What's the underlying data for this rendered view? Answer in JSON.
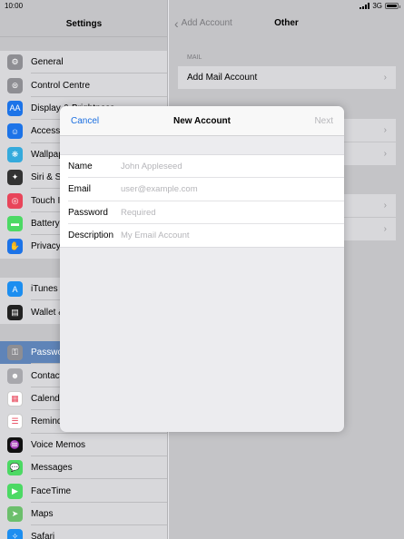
{
  "status": {
    "time": "10:00",
    "network": "3G"
  },
  "sidebar": {
    "title": "Settings",
    "group1": [
      {
        "label": "General",
        "icon": "gear-icon",
        "color": "#8e8e93",
        "glyph": "⚙"
      },
      {
        "label": "Control Centre",
        "icon": "switches-icon",
        "color": "#8e8e93",
        "glyph": "⊜"
      },
      {
        "label": "Display & Brightness",
        "icon": "text-size-icon",
        "color": "#1c73e8",
        "glyph": "AA"
      },
      {
        "label": "Accessibility",
        "icon": "accessibility-icon",
        "color": "#1c73e8",
        "glyph": "☺"
      },
      {
        "label": "Wallpaper",
        "icon": "flower-icon",
        "color": "#35aadc",
        "glyph": "❋"
      },
      {
        "label": "Siri & Search",
        "icon": "siri-icon",
        "color": "#333",
        "glyph": "✦"
      },
      {
        "label": "Touch ID & Passcode",
        "icon": "fingerprint-icon",
        "color": "#e8455a",
        "glyph": "◎"
      },
      {
        "label": "Battery",
        "icon": "battery-icon",
        "color": "#4cd964",
        "glyph": "▬"
      },
      {
        "label": "Privacy",
        "icon": "hand-icon",
        "color": "#1c73e8",
        "glyph": "✋"
      }
    ],
    "group2": [
      {
        "label": "iTunes & App Store",
        "icon": "app-store-icon",
        "color": "#1c8ef0",
        "glyph": "A"
      },
      {
        "label": "Wallet & Apple Pay",
        "icon": "wallet-icon",
        "color": "#222",
        "glyph": "▤"
      }
    ],
    "group3": [
      {
        "label": "Passwords & Accounts",
        "icon": "key-icon",
        "color": "#8e8e93",
        "glyph": "⚿",
        "selected": true
      },
      {
        "label": "Contacts",
        "icon": "contacts-icon",
        "color": "#a8a8ad",
        "glyph": "☻"
      },
      {
        "label": "Calendar",
        "icon": "calendar-icon",
        "color": "#ffffff",
        "glyph": "▦"
      },
      {
        "label": "Reminders",
        "icon": "reminders-icon",
        "color": "#ffffff",
        "glyph": "☰"
      },
      {
        "label": "Voice Memos",
        "icon": "voice-memos-icon",
        "color": "#111",
        "glyph": "♒"
      },
      {
        "label": "Messages",
        "icon": "messages-icon",
        "color": "#4cd964",
        "glyph": "💬"
      },
      {
        "label": "FaceTime",
        "icon": "facetime-icon",
        "color": "#4cd964",
        "glyph": "▶"
      },
      {
        "label": "Maps",
        "icon": "maps-icon",
        "color": "#6cbf6c",
        "glyph": "➤"
      },
      {
        "label": "Safari",
        "icon": "safari-icon",
        "color": "#1c8ef0",
        "glyph": "✧"
      }
    ]
  },
  "detail": {
    "back_label": "Add Account",
    "title": "Other",
    "mail_caption": "MAIL",
    "add_mail_label": "Add Mail Account"
  },
  "modal": {
    "cancel": "Cancel",
    "title": "New Account",
    "next": "Next",
    "fields": [
      {
        "label": "Name",
        "placeholder": "John Appleseed",
        "value": ""
      },
      {
        "label": "Email",
        "placeholder": "user@example.com",
        "value": ""
      },
      {
        "label": "Password",
        "placeholder": "Required",
        "value": ""
      },
      {
        "label": "Description",
        "placeholder": "My Email Account",
        "value": ""
      }
    ]
  }
}
